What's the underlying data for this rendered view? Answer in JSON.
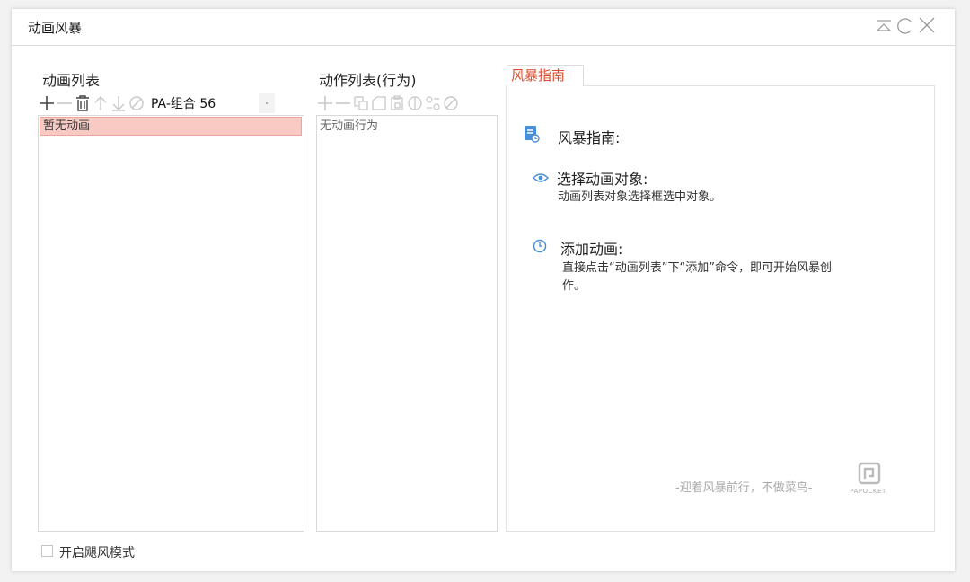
{
  "window": {
    "title": "动画风暴"
  },
  "animation_list": {
    "title": "动画列表",
    "combo_value": "PA-组合 56",
    "items": [
      "暂无动画"
    ]
  },
  "action_list": {
    "title": "动作列表(行为)",
    "empty_text": "无动画行为"
  },
  "guide": {
    "tab_label": "风暴指南",
    "header": "风暴指南:",
    "sections": [
      {
        "title": "选择动画对象:",
        "body": "动画列表对象选择框选中对象。",
        "icon": "eye-icon"
      },
      {
        "title": "添加动画:",
        "body_line1": "直接点击“动画列表”下“添加”命令，即可开始风暴创",
        "body_line2": "作。",
        "icon": "clock-icon"
      }
    ],
    "slogan": "-迎着风暴前行，不做菜鸟-",
    "logo_text": "PAPOCKET"
  },
  "footer": {
    "checkbox_label": "开启飓风模式",
    "checked": false
  },
  "colors": {
    "accent": "#e04a2a",
    "selected_row": "#f9c9c3",
    "icon_blue": "#4a90d9",
    "disabled_icon": "#c8c8c8"
  }
}
